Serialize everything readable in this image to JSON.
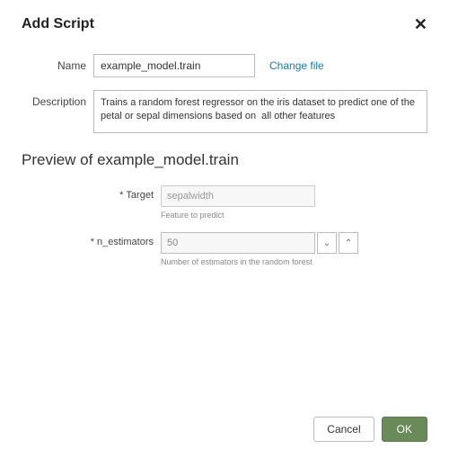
{
  "dialog": {
    "title": "Add Script",
    "close": "✕"
  },
  "form": {
    "name_label": "Name",
    "name_value": "example_model.train",
    "change_file": "Change file",
    "desc_label": "Description",
    "desc_value": "Trains a random forest regressor on the iris dataset to predict one of the petal or sepal dimensions based on  all other features"
  },
  "preview": {
    "heading": "Preview of example_model.train",
    "target": {
      "label": "Target",
      "value": "sepalwidth",
      "help": "Feature to predict"
    },
    "n_estimators": {
      "label": "n_estimators",
      "value": "50",
      "help": "Number of estimators in the random forest"
    }
  },
  "footer": {
    "cancel": "Cancel",
    "ok": "OK"
  },
  "glyph": {
    "asterisk": "*",
    "down": "⌄",
    "up": "⌃"
  }
}
